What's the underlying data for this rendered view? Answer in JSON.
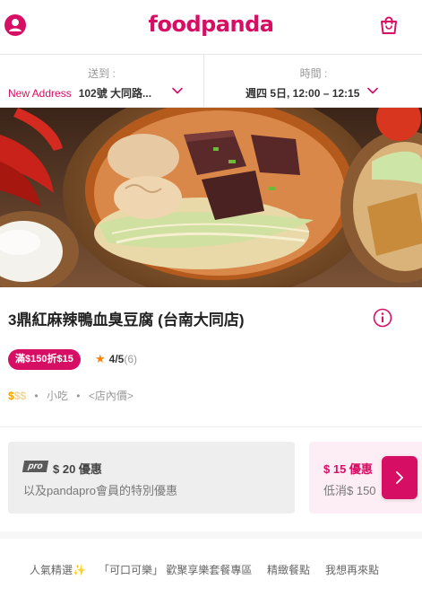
{
  "header": {
    "logo": "foodpanda",
    "profile_icon": "user-icon",
    "cart_icon": "shopping-bag-icon"
  },
  "delivery": {
    "deliver_to_label": "送到 :",
    "new_address_label": "New Address",
    "address": "102號 大同路...",
    "time_label": "時間 :",
    "time_value": "週四 5日, 12:00 – 12:15"
  },
  "restaurant": {
    "name": "3鼎紅麻辣鴨血臭豆腐 (台南大同店)",
    "promo_badge": "滿$150折$15",
    "rating": "4/5",
    "rating_count": "(6)",
    "price_level_on": "$",
    "price_level_off": "$$",
    "dot": "•",
    "cuisine": "小吃",
    "price_note": "<店內價>"
  },
  "deals": [
    {
      "tag": "pro",
      "title": "$ 20 優惠",
      "subtitle": "以及pandapro會員的特別優惠"
    },
    {
      "title": "$ 15 優惠",
      "subtitle": "低消$ 150"
    }
  ],
  "categories": [
    "人氣精選✨",
    "「可口可樂」 歡聚享樂套餐專區",
    "精緻餐點",
    "我想再來點"
  ],
  "colors": {
    "brand": "#d70f64",
    "star": "#ff8000",
    "price": "#f2a100"
  }
}
